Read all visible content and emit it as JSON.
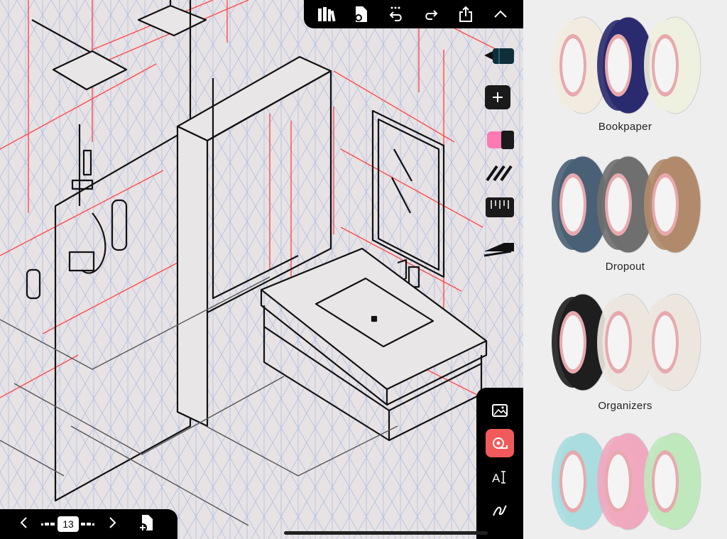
{
  "canvas": {
    "page_number": "13"
  },
  "toolbar": {
    "icons": [
      "library-icon",
      "document-settings-icon",
      "undo-icon",
      "redo-icon",
      "share-icon",
      "collapse-chevron-icon"
    ]
  },
  "tools": {
    "icons": [
      "pen-tool-icon",
      "add-tool-icon",
      "highlighter-icon",
      "hatch-brush-icon",
      "ruler-icon",
      "stroke-tool-icon"
    ]
  },
  "bottom_panel": {
    "icons": [
      "image-icon",
      "tape-icon",
      "text-tool-icon",
      "lasso-icon"
    ]
  },
  "pager": {
    "icons": [
      "previous-page-icon",
      "next-page-icon",
      "add-page-icon"
    ]
  },
  "sticker_panel": {
    "packs": [
      {
        "label": "Bookpaper",
        "colors": [
          "#f2ece0",
          "#2a2a6e",
          "#eef0e0"
        ]
      },
      {
        "label": "Dropout",
        "colors": [
          "#4a6076",
          "#6f6f6f",
          "#b08a6a"
        ]
      },
      {
        "label": "Organizers",
        "colors": [
          "#1e1e1e",
          "#ece6df",
          "#ece6df"
        ]
      },
      {
        "label": "",
        "colors": [
          "#a9dde0",
          "#efa9bf",
          "#bfe8bd"
        ]
      }
    ]
  },
  "colors": {
    "accent": "#f05a5a",
    "grid": "#9fb3e0",
    "guide_red": "#ff3b3b"
  }
}
